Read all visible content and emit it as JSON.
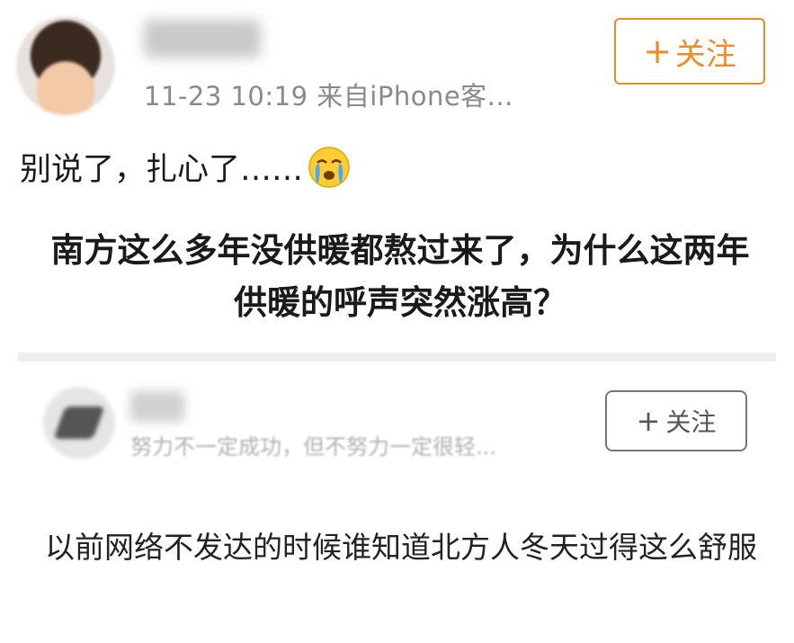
{
  "post": {
    "timestamp": "11-23 10:19",
    "source": "来自iPhone客...",
    "follow_plus": "+",
    "follow_label": "关注",
    "text": "别说了，扎心了……",
    "emoji": "crying-face-emoji",
    "question": "南方这么多年没供暖都熬过来了，为什么这两年供暖的呼声突然涨高？"
  },
  "answer": {
    "bio": "努力不一定成功，但不努力一定很轻...",
    "follow_plus": "+",
    "follow_label": "关注",
    "text": "以前网络不发达的时候谁知道北方人冬天过得这么舒服"
  },
  "colors": {
    "accent_orange": "#f08a24",
    "meta_gray": "#8a8a8a",
    "divider": "#eeeeee"
  }
}
